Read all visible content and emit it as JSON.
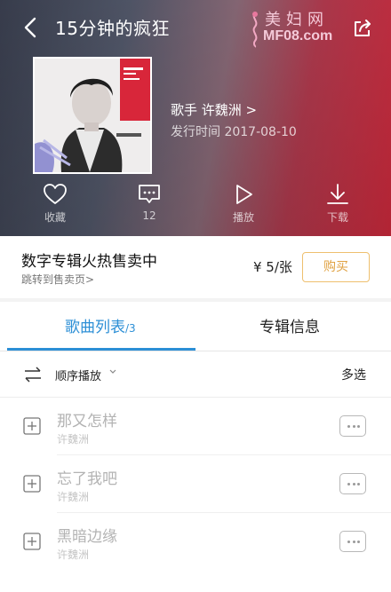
{
  "header": {
    "title": "15分钟的疯狂",
    "watermark_cn": "美妇网",
    "watermark_en": "MF08.com"
  },
  "album": {
    "artist": "歌手  许魏洲 >",
    "release": "发行时间  2017-08-10"
  },
  "actions": [
    {
      "label": "收藏",
      "icon": "heart-icon"
    },
    {
      "label": "12",
      "icon": "comment-icon"
    },
    {
      "label": "播放",
      "icon": "play-icon"
    },
    {
      "label": "下载",
      "icon": "download-icon"
    }
  ],
  "purchase": {
    "title": "数字专辑火热售卖中",
    "link": "跳转到售卖页>",
    "price": "¥ 5/张",
    "buy_label": "购买"
  },
  "tabs": {
    "songs_label": "歌曲列表",
    "songs_count": "/3",
    "info_label": "专辑信息"
  },
  "play_mode": {
    "label": "顺序播放",
    "multi_select": "多选"
  },
  "songs": [
    {
      "title": "那又怎样",
      "artist": "许魏洲"
    },
    {
      "title": "忘了我吧",
      "artist": "许魏洲"
    },
    {
      "title": "黑暗边缘",
      "artist": "许魏洲"
    }
  ],
  "colors": {
    "accent": "#2c8fd6",
    "buy": "#e0a243"
  }
}
